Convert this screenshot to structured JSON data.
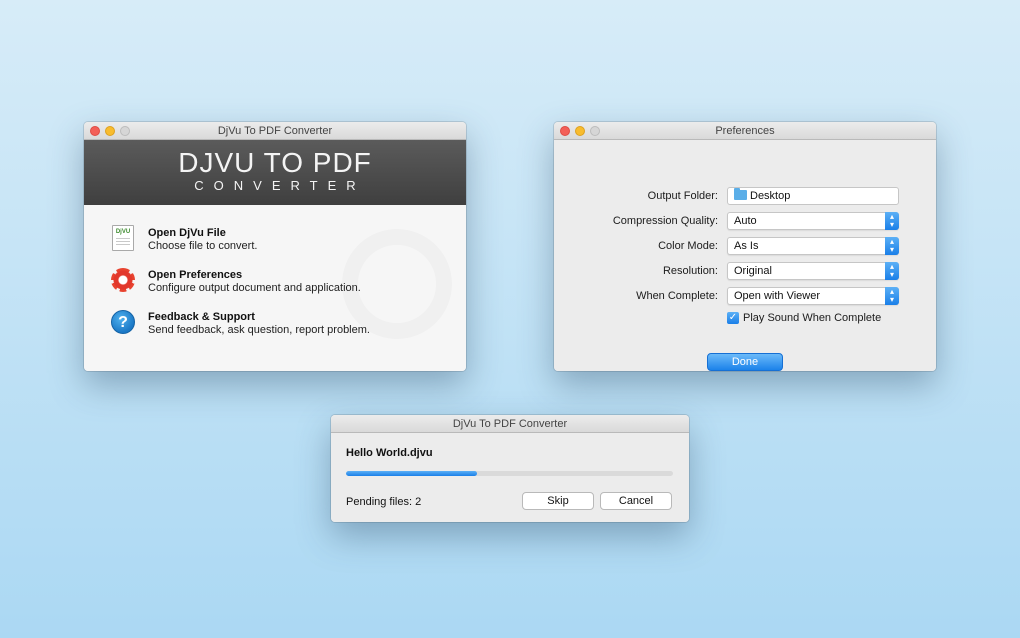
{
  "main_window": {
    "title": "DjVu To PDF Converter",
    "banner_title": "DJVU TO PDF",
    "banner_subtitle": "CONVERTER",
    "actions": [
      {
        "icon": "djvu-file-icon",
        "title": "Open DjVu File",
        "desc": "Choose file to convert."
      },
      {
        "icon": "gear-icon",
        "title": "Open Preferences",
        "desc": "Configure output document and application."
      },
      {
        "icon": "help-icon",
        "title": "Feedback & Support",
        "desc": "Send feedback, ask question, report problem."
      }
    ],
    "djvu_icon_text": "DjVU"
  },
  "prefs_window": {
    "title": "Preferences",
    "rows": [
      {
        "label": "Output Folder:",
        "value": "Desktop",
        "type": "folder"
      },
      {
        "label": "Compression Quality:",
        "value": "Auto",
        "type": "popup"
      },
      {
        "label": "Color Mode:",
        "value": "As Is",
        "type": "popup"
      },
      {
        "label": "Resolution:",
        "value": "Original",
        "type": "popup"
      },
      {
        "label": "When Complete:",
        "value": "Open with Viewer",
        "type": "popup"
      }
    ],
    "play_sound_label": "Play Sound When Complete",
    "play_sound_checked": true,
    "done_label": "Done"
  },
  "progress_window": {
    "title": "DjVu To PDF Converter",
    "file_name": "Hello World.djvu",
    "progress": 0.4,
    "pending_text": "Pending files: 2",
    "skip_label": "Skip",
    "cancel_label": "Cancel"
  },
  "colors": {
    "accent": "#1a7fe8",
    "close": "#f35f57",
    "minimize": "#f8bc2e"
  }
}
